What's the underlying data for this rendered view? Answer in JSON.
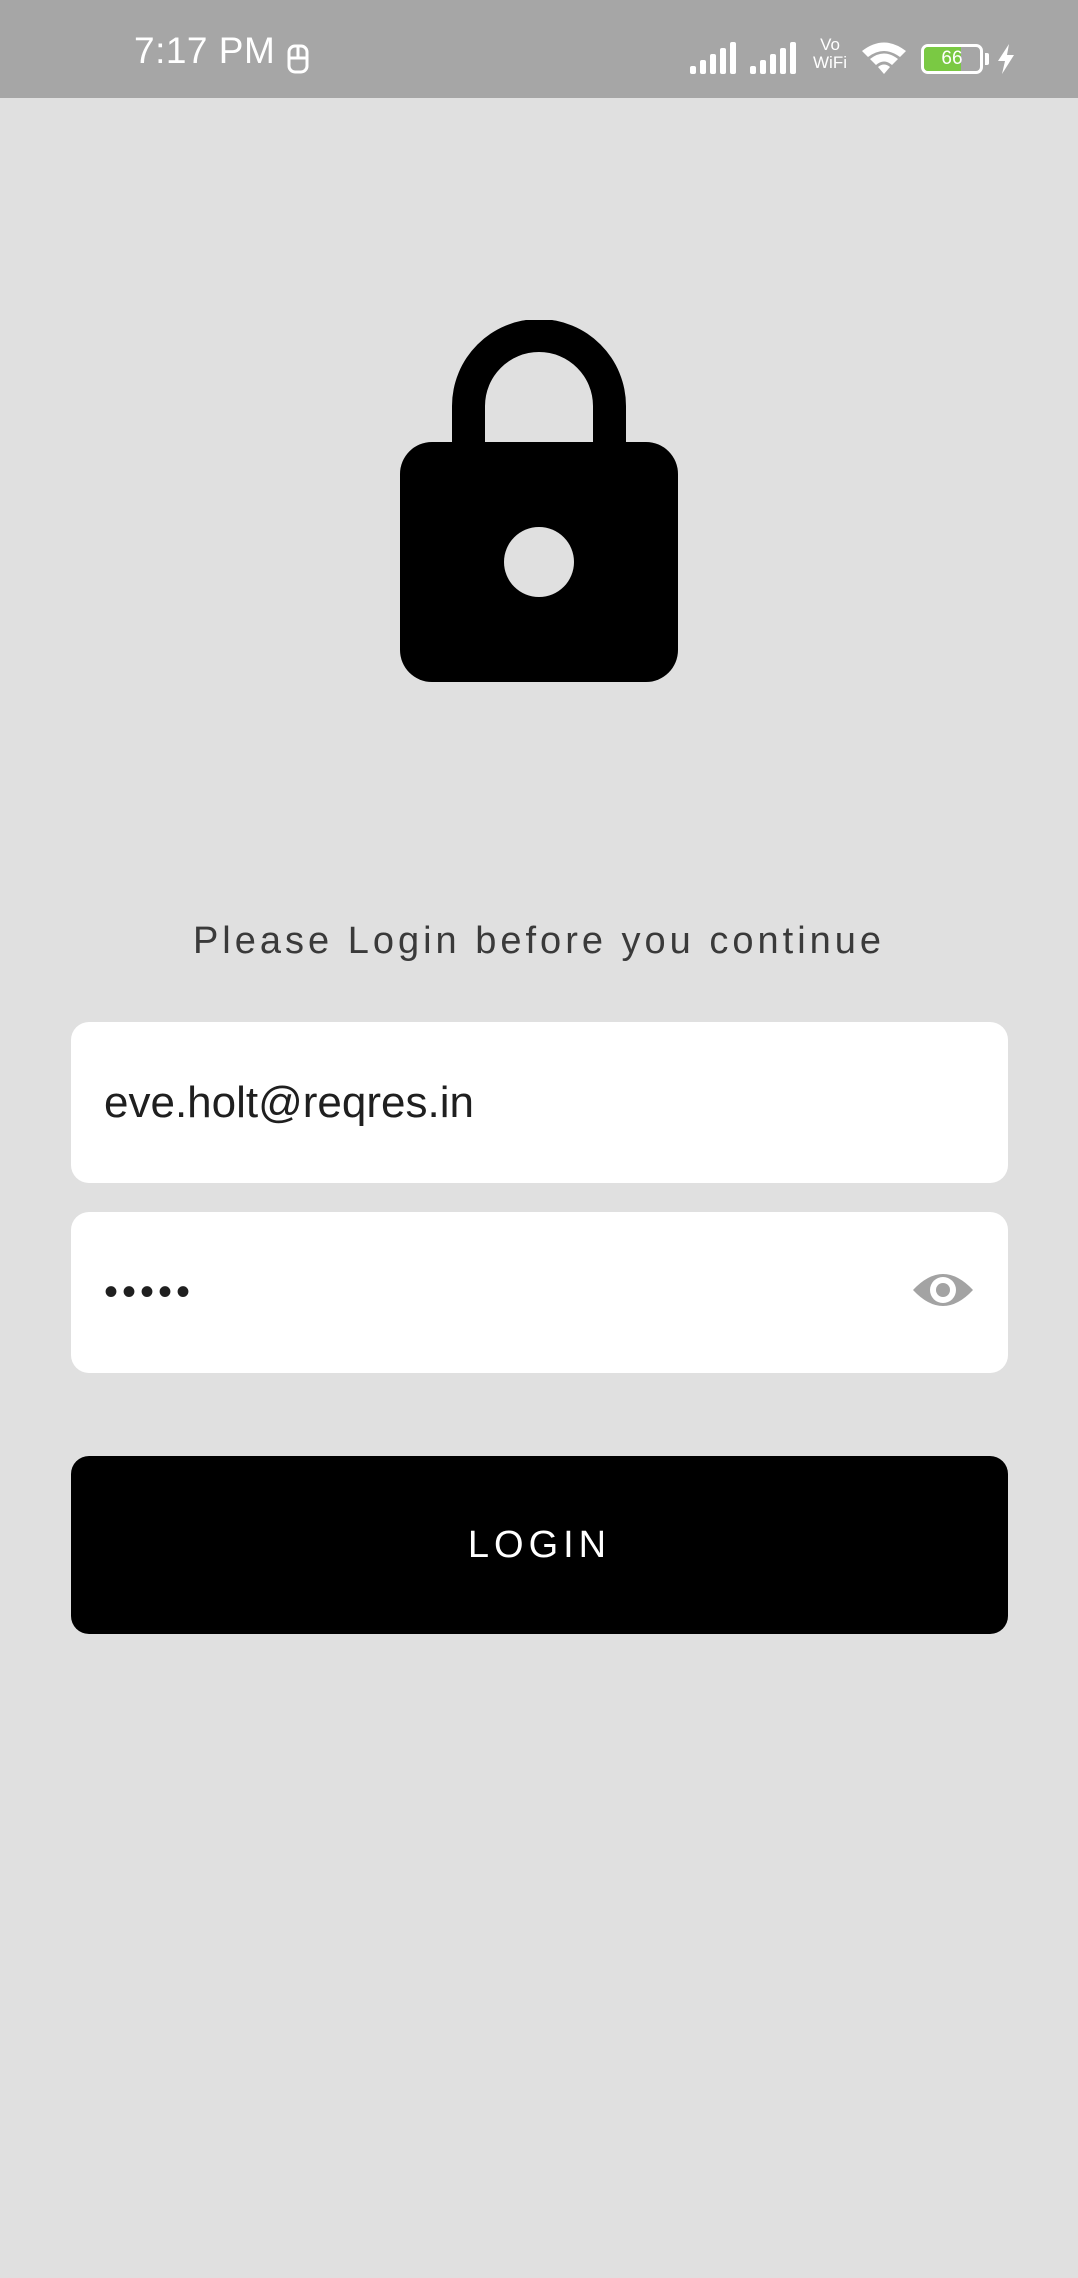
{
  "status_bar": {
    "time": "7:17 PM",
    "vowifi_top": "Vo",
    "vowifi_bottom": "WiFi",
    "battery_level": "66",
    "battery_fraction": 0.66,
    "icons": [
      "notification-icon",
      "signal-icon",
      "signal-icon",
      "vowifi-icon",
      "wifi-icon",
      "battery-icon",
      "charging-icon"
    ]
  },
  "header": {
    "icon": "lock-icon"
  },
  "login": {
    "prompt": "Please Login before you continue",
    "email_value": "eve.holt@reqres.in",
    "password_value": "•••••",
    "password_toggle_icon": "eye-icon",
    "button_label": "LOGIN"
  },
  "colors": {
    "background": "#e0e0e0",
    "status_bar": "#a6a6a6",
    "button": "#000000",
    "battery_fill": "#7ac943"
  }
}
